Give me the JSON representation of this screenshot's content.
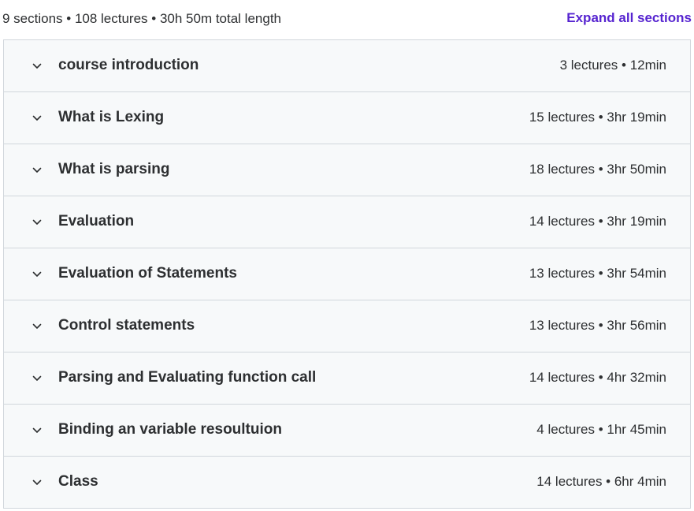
{
  "header": {
    "summary": "9 sections • 108 lectures • 30h 50m total length",
    "expand_all_label": "Expand all sections"
  },
  "colors": {
    "accent": "#5624d0",
    "row_background": "#f7f9fa",
    "border": "#d1d7dc",
    "text": "#2d2f31"
  },
  "sections": [
    {
      "title": "course introduction",
      "meta": "3 lectures • 12min",
      "icon": "chevron-down-icon"
    },
    {
      "title": "What is Lexing",
      "meta": "15 lectures • 3hr 19min",
      "icon": "chevron-down-icon"
    },
    {
      "title": "What is parsing",
      "meta": "18 lectures • 3hr 50min",
      "icon": "chevron-down-icon"
    },
    {
      "title": "Evaluation",
      "meta": "14 lectures • 3hr 19min",
      "icon": "chevron-down-icon"
    },
    {
      "title": "Evaluation of Statements",
      "meta": "13 lectures • 3hr 54min",
      "icon": "chevron-down-icon"
    },
    {
      "title": "Control statements",
      "meta": "13 lectures • 3hr 56min",
      "icon": "chevron-down-icon"
    },
    {
      "title": "Parsing and Evaluating function call",
      "meta": "14 lectures • 4hr 32min",
      "icon": "chevron-down-icon"
    },
    {
      "title": "Binding an variable resoultuion",
      "meta": "4 lectures • 1hr 45min",
      "icon": "chevron-down-icon"
    },
    {
      "title": "Class",
      "meta": "14 lectures • 6hr 4min",
      "icon": "chevron-down-icon"
    }
  ]
}
